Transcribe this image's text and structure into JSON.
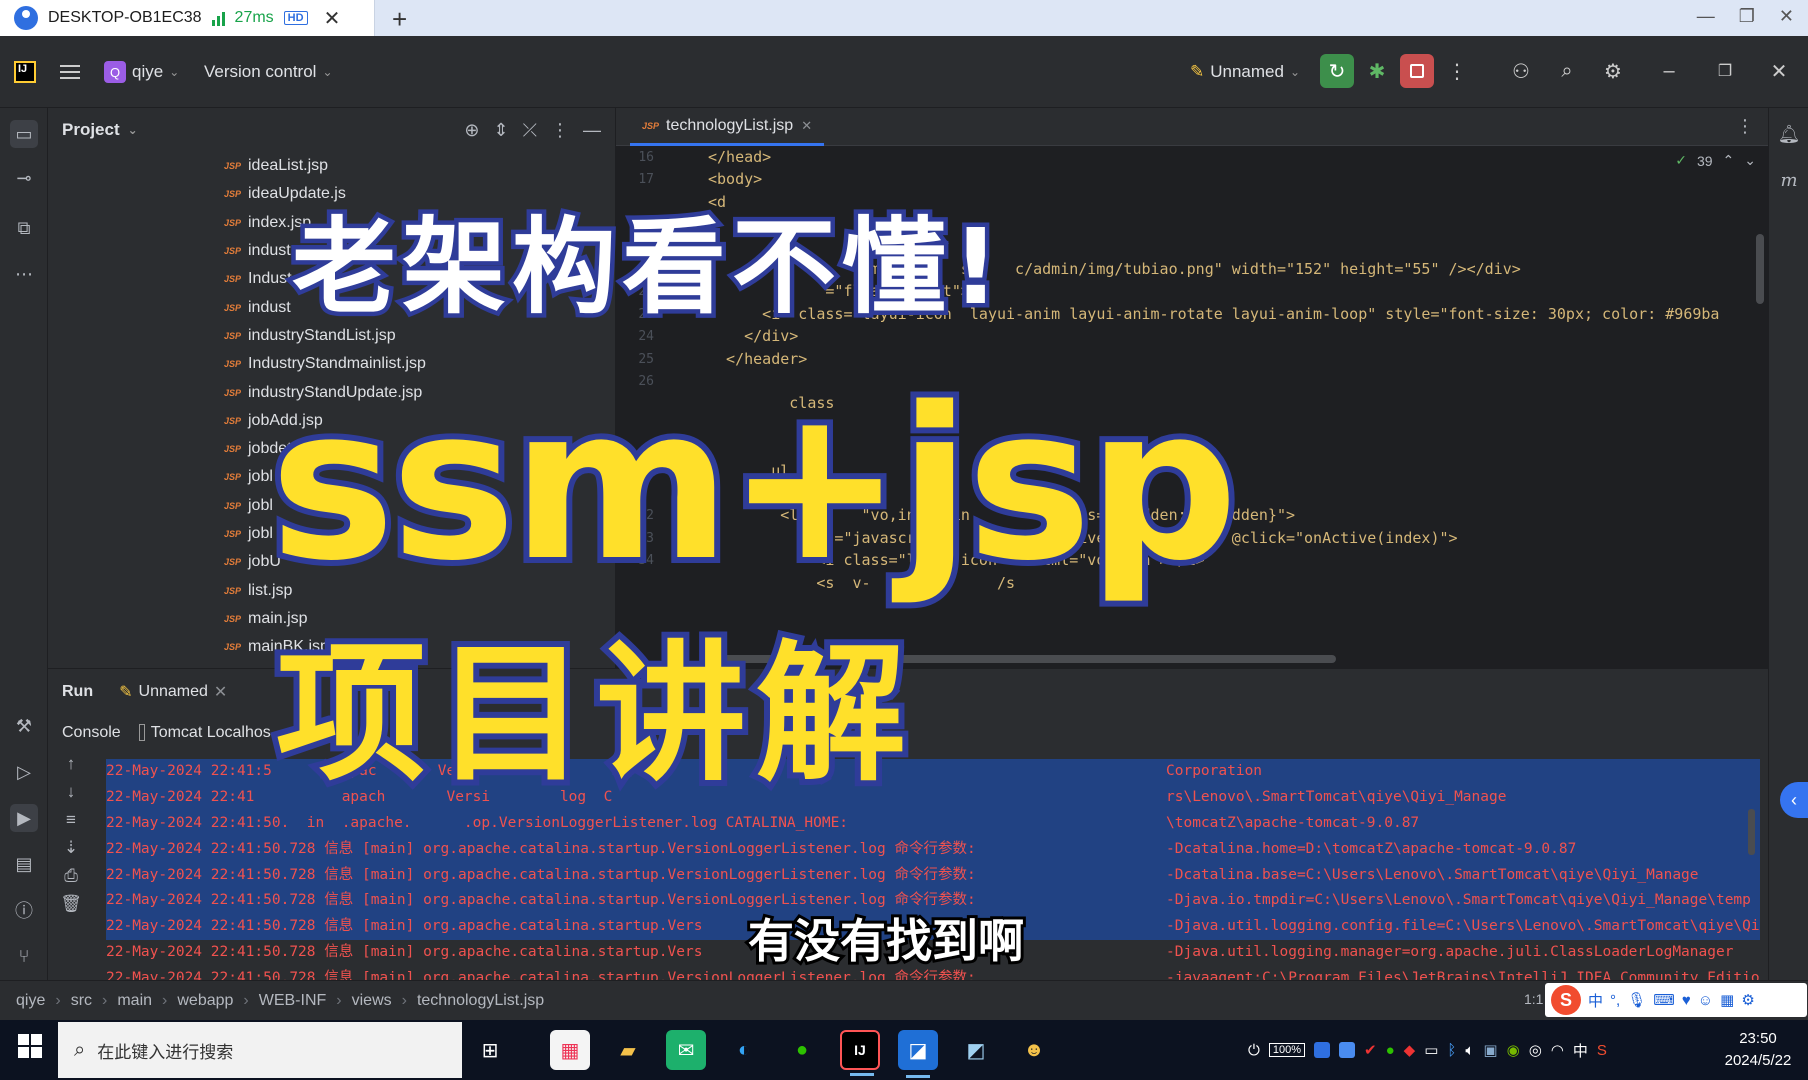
{
  "remote_desktop": {
    "tab_title": "DESKTOP-OB1EC38",
    "latency": "27ms",
    "hd_badge": "HD"
  },
  "ide": {
    "project_name": "qiye",
    "version_control": "Version control",
    "run_config": "Unnamed"
  },
  "project_panel": {
    "title": "Project",
    "files": [
      "ideaList.jsp",
      "ideaUpdate.js",
      "index.jsp",
      "indust",
      "Indust",
      "indust",
      "industryStandList.jsp",
      "IndustryStandmainlist.jsp",
      "industryStandUpdate.jsp",
      "jobAdd.jsp",
      "jobdet",
      "jobl",
      "jobl",
      "jobl",
      "jobU",
      "list.jsp",
      "main.jsp",
      "mainBK.jsp"
    ]
  },
  "editor": {
    "tab": "technologyList.jsp",
    "inspection_count": "39",
    "lines": [
      {
        "n": "16",
        "indent": 0,
        "t": "</head>"
      },
      {
        "n": "17",
        "indent": 0,
        "t": "<body>"
      },
      {
        "n": "",
        "indent": 0,
        "t": "<d"
      },
      {
        "n": "",
        "indent": 0,
        "t": ""
      },
      {
        "n": "",
        "indent": 0,
        "t": ""
      },
      {
        "n": "",
        "indent": 0,
        "t": "                 img        s/    c/admin/img/tubiao.png\" width=\"152\" height=\"55\" /></div>"
      },
      {
        "n": "22",
        "indent": 0,
        "t": "             =\"float    ght\">"
      },
      {
        "n": "23",
        "indent": 0,
        "t": "      <i  class=\"layui-icon  layui-anim layui-anim-rotate layui-anim-loop\" style=\"font-size: 30px; color: #969ba"
      },
      {
        "n": "24",
        "indent": 0,
        "t": "    </div>"
      },
      {
        "n": "25",
        "indent": 0,
        "t": "  </header>"
      },
      {
        "n": "26",
        "indent": 0,
        "t": ""
      },
      {
        "n": "",
        "indent": 0,
        "t": "         class"
      },
      {
        "n": "",
        "indent": 0,
        "t": ""
      },
      {
        "n": "",
        "indent": 0,
        "t": ""
      },
      {
        "n": "",
        "indent": 0,
        "t": "       ul cl"
      },
      {
        "n": "",
        "indent": 0,
        "t": "        <!--"
      },
      {
        "n": "32",
        "indent": 0,
        "t": "        <l       \"vo,index in        .class=\"{hidden:vo.hidden}\">"
      },
      {
        "n": "33",
        "indent": 0,
        "t": "              =\"javascript:    lass=\"{active:vo.active}\"  @click=\"onActive(index)\">"
      },
      {
        "n": "34",
        "indent": 0,
        "t": "            <i class=\"layui-icon\" v-html=\"vo.icon\"></i>"
      },
      {
        "n": "",
        "indent": 0,
        "t": "            <s  v-   =\"vo.n     /s"
      }
    ]
  },
  "run_panel": {
    "title": "Run",
    "config_tab": "Unnamed",
    "sub_tabs": [
      "Console",
      "Tomcat Localhos",
      "cess"
    ],
    "log_lines": [
      {
        "left": "22-May-2024 22:41:5        apac       Versi",
        "right": "Corporation",
        "sel": true
      },
      {
        "left": "22-May-2024 22:41          apach       Versi        log  C",
        "right": "rs\\Lenovo\\.SmartTomcat\\qiye\\Qiyi_Manage",
        "sel": true
      },
      {
        "left": "22-May-2024 22:41:50.  in  .apache.      .op.VersionLoggerListener.log CATALINA_HOME:",
        "right": "\\tomcatZ\\apache-tomcat-9.0.87",
        "sel": true
      },
      {
        "left": "22-May-2024 22:41:50.728 信息 [main] org.apache.catalina.startup.VersionLoggerListener.log 命令行参数:",
        "right": "-Dcatalina.home=D:\\tomcatZ\\apache-tomcat-9.0.87",
        "sel": true
      },
      {
        "left": "22-May-2024 22:41:50.728 信息 [main] org.apache.catalina.startup.VersionLoggerListener.log 命令行参数:",
        "right": "-Dcatalina.base=C:\\Users\\Lenovo\\.SmartTomcat\\qiye\\Qiyi_Manage",
        "sel": true
      },
      {
        "left": "22-May-2024 22:41:50.728 信息 [main] org.apache.catalina.startup.VersionLoggerListener.log 命令行参数:",
        "right": "-Djava.io.tmpdir=C:\\Users\\Lenovo\\.SmartTomcat\\qiye\\Qiyi_Manage\\temp",
        "sel": true
      },
      {
        "left": "22-May-2024 22:41:50.728 信息 [main] org.apache.catalina.startup.Vers",
        "right": "-Djava.util.logging.config.file=C:\\Users\\Lenovo\\.SmartTomcat\\qiye\\Qiy",
        "sel": true
      },
      {
        "left": "22-May-2024 22:41:50.728 信息 [main] org.apache.catalina.startup.Vers",
        "right": "-Djava.util.logging.manager=org.apache.juli.ClassLoaderLogManager",
        "sel": false
      },
      {
        "left": "22-May-2024 22:41:50.728 信息 [main] org.apache.catalina.startup.VersionLoggerListener.log 命令行参数:",
        "right": "-javaagent:C:\\Program Files\\JetBrains\\IntelliJ IDEA Community Edition",
        "sel": false
      }
    ]
  },
  "status_bar": {
    "breadcrumb": [
      "qiye",
      "src",
      "main",
      "webapp",
      "WEB-INF",
      "views",
      "technologyList.jsp"
    ],
    "position": "1:1"
  },
  "ime_bar": {
    "lang": "中",
    "punct": "°,"
  },
  "taskbar": {
    "search_placeholder": "在此键入进行搜索",
    "battery": "100%",
    "input_lang": "中",
    "time": "23:50",
    "date": "2024/5/22"
  },
  "overlay": {
    "line1": "老架构看不懂!",
    "line2": "ssm+jsp",
    "line3": "项目讲解",
    "subtitle": "有没有找到啊"
  },
  "colors": {
    "overlay_yellow": "#ffe02a",
    "overlay_outline": "#2f3c99",
    "accent": "#3574f0",
    "log_red": "#f0524f",
    "selection": "#214283"
  }
}
